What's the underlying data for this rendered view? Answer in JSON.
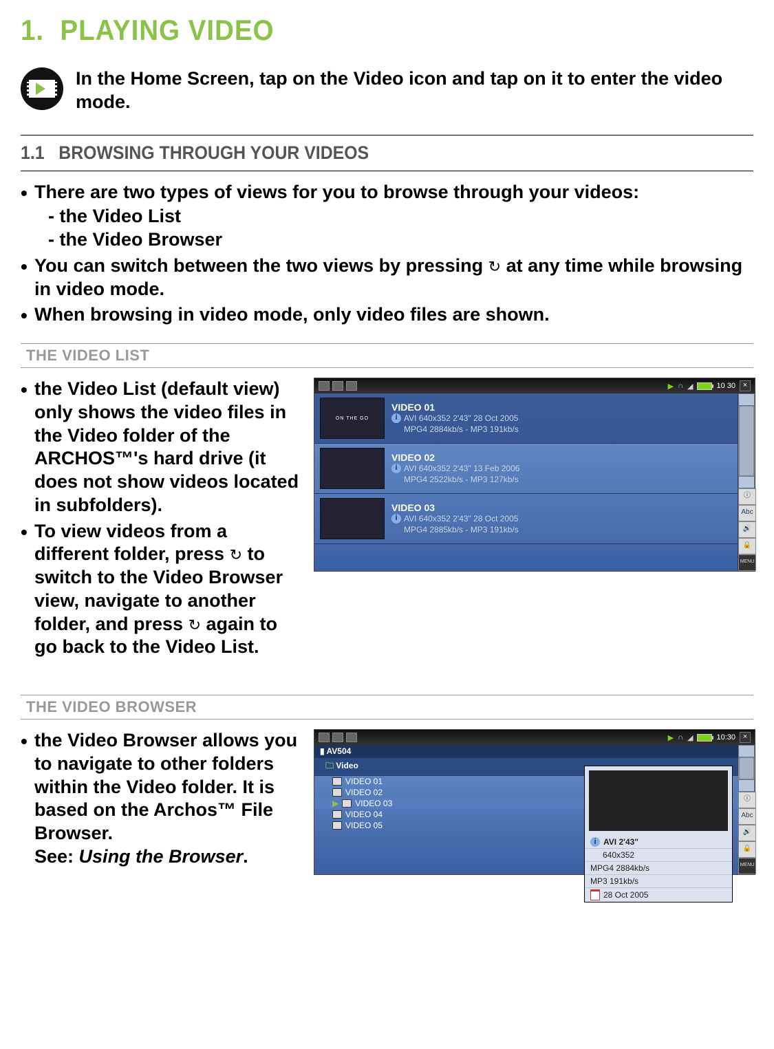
{
  "chapter": {
    "number": "1.",
    "title": "PLAYING VIDEO"
  },
  "intro": "In the Home Screen, tap on the Video icon and tap on it to enter the video mode.",
  "section11": {
    "number": "1.1",
    "title": "BROWSING THROUGH YOUR VIDEOS",
    "bullet1": "There are two types of views for you to browse through your videos:",
    "sub_a": "the Video List",
    "sub_b": "the Video Browser",
    "bullet2_pre": "You can switch between the two views by pressing ",
    "bullet2_post": " at any time while browsing in video mode.",
    "bullet3": "When browsing in video mode, only video files are shown."
  },
  "videoListSec": {
    "heading": "THE VIDEO LIST",
    "b1": "the Video List (default view) only shows the video files in the Video folder of the ARCHOS™'s hard drive (it does not show videos located in subfolders).",
    "b2_pre": "To view videos from a different folder, press ",
    "b2_mid": " to switch to the Video Browser view, navigate to another folder, and press ",
    "b2_post": " again to go back to the Video List.",
    "screen": {
      "time": "10 30",
      "rows": [
        {
          "title": "VIDEO 01",
          "thumb": "ON THE GO",
          "meta1": "AVI 640x352 2'43\" 28 Oct 2005",
          "meta2": "MPG4 2884kb/s - MP3 191kb/s"
        },
        {
          "title": "VIDEO 02",
          "thumb": "",
          "meta1": "AVI 640x352 2'43\" 13 Feb 2006",
          "meta2": "MPG4 2522kb/s - MP3 127kb/s"
        },
        {
          "title": "VIDEO 03",
          "thumb": "",
          "meta1": "AVI 640x352 2'43\" 28 Oct 2005",
          "meta2": "MPG4 2885kb/s - MP3 191kb/s"
        }
      ],
      "rail": {
        "abc": "Abc",
        "menu": "MENU"
      }
    }
  },
  "videoBrowserSec": {
    "heading": "THE VIDEO BROWSER",
    "b1": "the Video Browser allows you to navigate to other folders within the Video folder. It is based on the Archos™ File Browser.",
    "see_pre": "See: ",
    "see_ref": "Using the Browser",
    "see_post": ".",
    "screen": {
      "time": "10:30",
      "header": "AV504",
      "folder": "Video",
      "files": [
        "VIDEO 01",
        "VIDEO 02",
        "VIDEO 03",
        "VIDEO 04",
        "VIDEO 05"
      ],
      "preview": {
        "title": "AVI 2'43\"",
        "res": "640x352",
        "l1": "MPG4 2884kb/s",
        "l2": "MP3 191kb/s",
        "date": "28 Oct 2005"
      },
      "rail": {
        "abc": "Abc",
        "menu": "MENU"
      }
    }
  }
}
